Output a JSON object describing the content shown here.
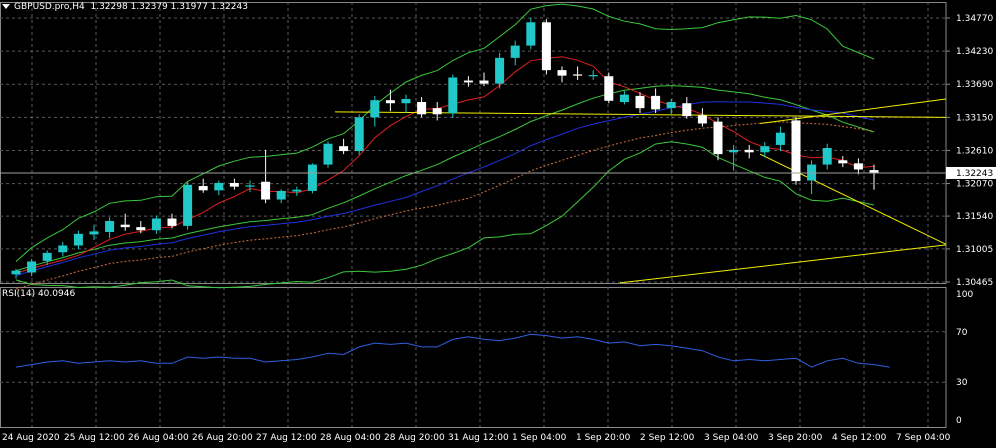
{
  "header": {
    "symbol": "GBPUSD.pro,H4",
    "ohlc": "1.32298 1.32379 1.31977 1.32243"
  },
  "rsi_header": {
    "label": "RSI(14) 40.0946"
  },
  "colors": {
    "background": "#000000",
    "grid": "#5a5a5a",
    "bull": "#20c8c8",
    "bear": "#ffffff",
    "bollinger": "#3cc83c",
    "red_line": "#e02020",
    "blue_line": "#2030e0",
    "trendline": "#f0f000",
    "rsi_line": "#3060e0",
    "current_price_line": "#a0a0a0"
  },
  "price_axis": [
    "1.34770",
    "1.34230",
    "1.33690",
    "1.33150",
    "1.32610",
    "1.32243",
    "1.32070",
    "1.31540",
    "1.31005",
    "1.30465"
  ],
  "current_price": "1.32243",
  "rsi_axis": [
    "100",
    "70",
    "30",
    "0"
  ],
  "time_axis": [
    "24 Aug 2020",
    "25 Aug 12:00",
    "26 Aug 04:00",
    "26 Aug 20:00",
    "27 Aug 12:00",
    "28 Aug 04:00",
    "28 Aug 20:00",
    "31 Aug 12:00",
    "1 Sep 04:00",
    "1 Sep 20:00",
    "2 Sep 12:00",
    "3 Sep 04:00",
    "3 Sep 20:00",
    "4 Sep 12:00",
    "7 Sep 04:00"
  ],
  "chart_data": {
    "type": "candlestick",
    "title": "GBPUSD.pro,H4",
    "y_range": [
      1.30465,
      1.3477
    ],
    "candles": [
      {
        "o": 1.3059,
        "h": 1.3068,
        "l": 1.3052,
        "c": 1.3065
      },
      {
        "o": 1.3062,
        "h": 1.3084,
        "l": 1.3056,
        "c": 1.308
      },
      {
        "o": 1.3081,
        "h": 1.3098,
        "l": 1.3074,
        "c": 1.3094
      },
      {
        "o": 1.3095,
        "h": 1.3112,
        "l": 1.3088,
        "c": 1.3106
      },
      {
        "o": 1.3106,
        "h": 1.313,
        "l": 1.31,
        "c": 1.3125
      },
      {
        "o": 1.3124,
        "h": 1.314,
        "l": 1.3115,
        "c": 1.3129
      },
      {
        "o": 1.3128,
        "h": 1.3152,
        "l": 1.3118,
        "c": 1.3146
      },
      {
        "o": 1.314,
        "h": 1.3158,
        "l": 1.313,
        "c": 1.3136
      },
      {
        "o": 1.3136,
        "h": 1.3146,
        "l": 1.3126,
        "c": 1.3131
      },
      {
        "o": 1.3131,
        "h": 1.3155,
        "l": 1.3125,
        "c": 1.315
      },
      {
        "o": 1.315,
        "h": 1.3158,
        "l": 1.3134,
        "c": 1.3138
      },
      {
        "o": 1.3138,
        "h": 1.321,
        "l": 1.3132,
        "c": 1.3205
      },
      {
        "o": 1.3203,
        "h": 1.3215,
        "l": 1.3192,
        "c": 1.3196
      },
      {
        "o": 1.3196,
        "h": 1.3212,
        "l": 1.3188,
        "c": 1.3208
      },
      {
        "o": 1.3208,
        "h": 1.3215,
        "l": 1.3197,
        "c": 1.3202
      },
      {
        "o": 1.3202,
        "h": 1.3212,
        "l": 1.3193,
        "c": 1.3204
      },
      {
        "o": 1.321,
        "h": 1.3262,
        "l": 1.3175,
        "c": 1.3181
      },
      {
        "o": 1.3181,
        "h": 1.3198,
        "l": 1.3175,
        "c": 1.3195
      },
      {
        "o": 1.3194,
        "h": 1.3202,
        "l": 1.3187,
        "c": 1.3197
      },
      {
        "o": 1.3195,
        "h": 1.324,
        "l": 1.3191,
        "c": 1.3238
      },
      {
        "o": 1.3238,
        "h": 1.3276,
        "l": 1.3233,
        "c": 1.3272
      },
      {
        "o": 1.3268,
        "h": 1.328,
        "l": 1.3255,
        "c": 1.326
      },
      {
        "o": 1.326,
        "h": 1.332,
        "l": 1.3254,
        "c": 1.3315
      },
      {
        "o": 1.3315,
        "h": 1.335,
        "l": 1.33,
        "c": 1.3343
      },
      {
        "o": 1.3343,
        "h": 1.336,
        "l": 1.3325,
        "c": 1.3338
      },
      {
        "o": 1.3338,
        "h": 1.3352,
        "l": 1.3322,
        "c": 1.3345
      },
      {
        "o": 1.334,
        "h": 1.3348,
        "l": 1.3315,
        "c": 1.332
      },
      {
        "o": 1.333,
        "h": 1.334,
        "l": 1.331,
        "c": 1.332
      },
      {
        "o": 1.3322,
        "h": 1.3385,
        "l": 1.3314,
        "c": 1.338
      },
      {
        "o": 1.3375,
        "h": 1.3382,
        "l": 1.3365,
        "c": 1.3372
      },
      {
        "o": 1.3375,
        "h": 1.3388,
        "l": 1.3366,
        "c": 1.337
      },
      {
        "o": 1.337,
        "h": 1.342,
        "l": 1.3362,
        "c": 1.3412
      },
      {
        "o": 1.3412,
        "h": 1.344,
        "l": 1.34,
        "c": 1.3432
      },
      {
        "o": 1.3432,
        "h": 1.3478,
        "l": 1.3426,
        "c": 1.347
      },
      {
        "o": 1.347,
        "h": 1.3475,
        "l": 1.3385,
        "c": 1.3392
      },
      {
        "o": 1.3392,
        "h": 1.3398,
        "l": 1.3372,
        "c": 1.3383
      },
      {
        "o": 1.3385,
        "h": 1.3398,
        "l": 1.3376,
        "c": 1.3383
      },
      {
        "o": 1.3382,
        "h": 1.3392,
        "l": 1.3376,
        "c": 1.3384
      },
      {
        "o": 1.3382,
        "h": 1.3388,
        "l": 1.3338,
        "c": 1.3342
      },
      {
        "o": 1.334,
        "h": 1.3358,
        "l": 1.3336,
        "c": 1.3352
      },
      {
        "o": 1.335,
        "h": 1.3356,
        "l": 1.3322,
        "c": 1.333
      },
      {
        "o": 1.335,
        "h": 1.3362,
        "l": 1.3322,
        "c": 1.3328
      },
      {
        "o": 1.333,
        "h": 1.3345,
        "l": 1.332,
        "c": 1.334
      },
      {
        "o": 1.3338,
        "h": 1.3348,
        "l": 1.3313,
        "c": 1.3317
      },
      {
        "o": 1.3318,
        "h": 1.333,
        "l": 1.33,
        "c": 1.3305
      },
      {
        "o": 1.3308,
        "h": 1.3315,
        "l": 1.3245,
        "c": 1.3255
      },
      {
        "o": 1.3258,
        "h": 1.327,
        "l": 1.3228,
        "c": 1.3262
      },
      {
        "o": 1.3262,
        "h": 1.327,
        "l": 1.3248,
        "c": 1.3258
      },
      {
        "o": 1.3258,
        "h": 1.3275,
        "l": 1.325,
        "c": 1.3268
      },
      {
        "o": 1.327,
        "h": 1.33,
        "l": 1.326,
        "c": 1.329
      },
      {
        "o": 1.331,
        "h": 1.3316,
        "l": 1.3205,
        "c": 1.3211
      },
      {
        "o": 1.3212,
        "h": 1.3245,
        "l": 1.319,
        "c": 1.3238
      },
      {
        "o": 1.3238,
        "h": 1.3272,
        "l": 1.323,
        "c": 1.3265
      },
      {
        "o": 1.3245,
        "h": 1.3252,
        "l": 1.3234,
        "c": 1.324
      },
      {
        "o": 1.324,
        "h": 1.3248,
        "l": 1.3222,
        "c": 1.323
      },
      {
        "o": 1.3229,
        "h": 1.3238,
        "l": 1.3197,
        "c": 1.3224
      }
    ],
    "indicators": [
      {
        "name": "RSI(14)",
        "value": 40.0946,
        "range": [
          0,
          100
        ],
        "values": [
          42,
          44,
          46,
          47,
          45,
          46,
          47,
          46,
          47,
          45,
          45,
          50,
          49,
          50,
          49,
          49,
          46,
          47,
          48,
          50,
          53,
          52,
          58,
          61,
          60,
          61,
          58,
          58,
          64,
          66,
          64,
          63,
          65,
          68,
          67,
          65,
          66,
          64,
          61,
          62,
          59,
          60,
          59,
          57,
          55,
          50,
          47,
          48,
          47,
          48,
          49,
          42,
          47,
          49,
          45,
          44,
          42
        ]
      }
    ]
  }
}
